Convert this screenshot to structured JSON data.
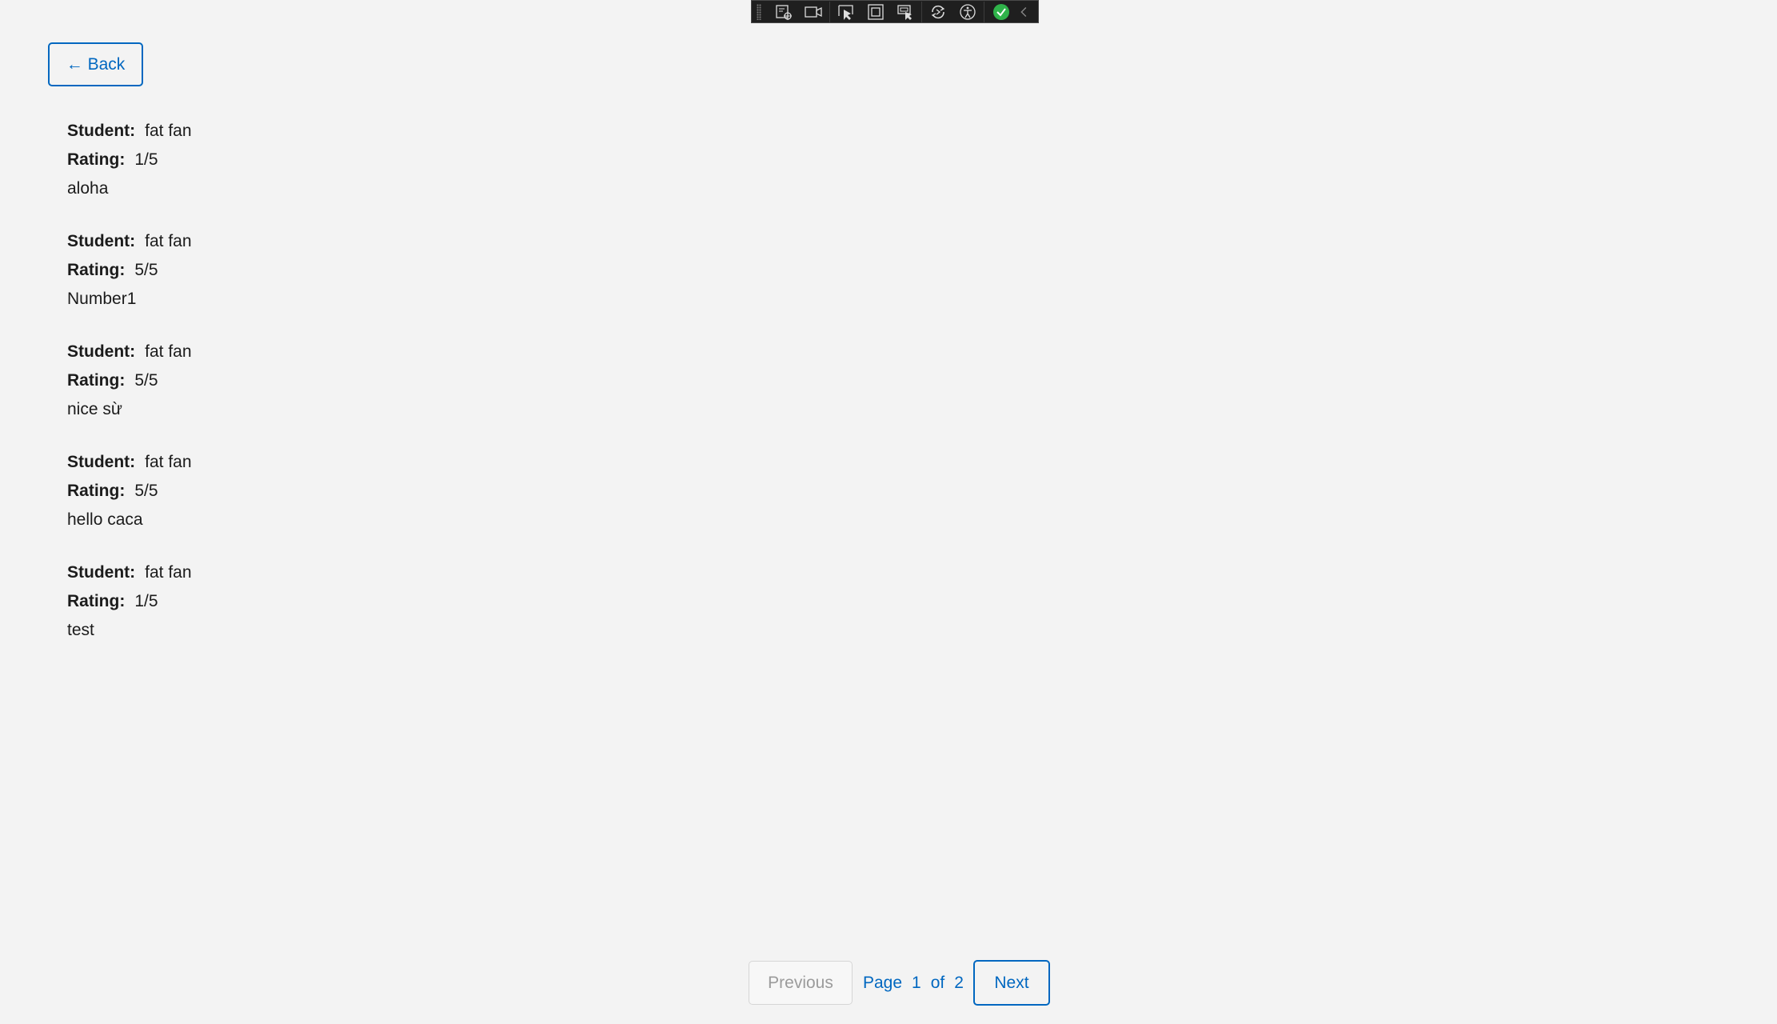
{
  "toolbar": {
    "icons": [
      "live-visual-tree-icon",
      "record-icon",
      "select-element-icon",
      "display-layout-adorners-icon",
      "track-focus-icon",
      "hot-reload-icon",
      "accessibility-icon",
      "binding-ok-icon",
      "collapse-toolbar-icon"
    ],
    "accent": "#2fb34a"
  },
  "back_button": {
    "label": "← Back"
  },
  "reviews": [
    {
      "student_label": "Student:",
      "student": "fat fan",
      "rating_label": "Rating:",
      "rating": "1/5",
      "comment": "aloha"
    },
    {
      "student_label": "Student:",
      "student": "fat fan",
      "rating_label": "Rating:",
      "rating": "5/5",
      "comment": "Number1"
    },
    {
      "student_label": "Student:",
      "student": "fat fan",
      "rating_label": "Rating:",
      "rating": "5/5",
      "comment": "nice sừ"
    },
    {
      "student_label": "Student:",
      "student": "fat fan",
      "rating_label": "Rating:",
      "rating": "5/5",
      "comment": "hello caca"
    },
    {
      "student_label": "Student:",
      "student": "fat fan",
      "rating_label": "Rating:",
      "rating": "1/5",
      "comment": "test"
    }
  ],
  "pagination": {
    "previous_label": "Previous",
    "page_word": "Page",
    "current_page": "1",
    "of_word": "of",
    "total_pages": "2",
    "next_label": "Next"
  },
  "colors": {
    "accent": "#0067c0",
    "background": "#f3f3f3"
  }
}
